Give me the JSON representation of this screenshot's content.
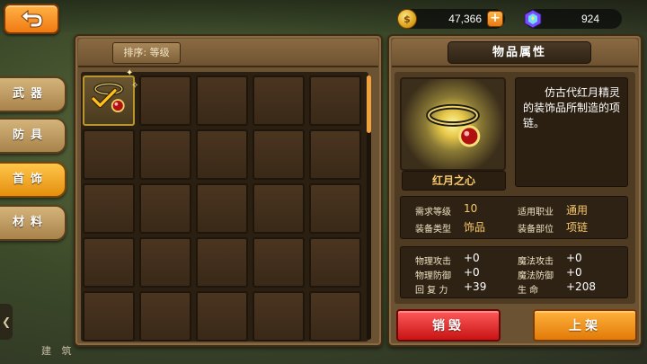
{
  "currency": {
    "gold": "47,366",
    "gold_plus": "+",
    "gems": "924"
  },
  "tabs": [
    {
      "label": "武器",
      "active": false
    },
    {
      "label": "防具",
      "active": false
    },
    {
      "label": "首饰",
      "active": true
    },
    {
      "label": "材料",
      "active": false
    }
  ],
  "under_text": "建 筑",
  "inventory": {
    "sort_label": "排序: 等级"
  },
  "details": {
    "title": "物品属性",
    "item_name": "红月之心",
    "description": "仿古代红月精灵的装饰品所制造的项链。",
    "stats1": [
      {
        "label": "需求等级",
        "value": "10"
      },
      {
        "label": "适用职业",
        "value": "通用"
      },
      {
        "label": "装备类型",
        "value": "饰品"
      },
      {
        "label": "装备部位",
        "value": "项链"
      }
    ],
    "stats2": [
      {
        "label": "物理攻击",
        "value": "+0"
      },
      {
        "label": "魔法攻击",
        "value": "+0"
      },
      {
        "label": "物理防御",
        "value": "+0"
      },
      {
        "label": "魔法防御",
        "value": "+0"
      },
      {
        "label": "回 复 力",
        "value": "+39"
      },
      {
        "label": "生 命",
        "value": "+208"
      }
    ],
    "destroy_label": "销毁",
    "list_label": "上架"
  },
  "icons": [
    "back-arrow-icon",
    "gold-coin-icon",
    "gem-icon",
    "checkmark-icon",
    "necklace-icon"
  ]
}
